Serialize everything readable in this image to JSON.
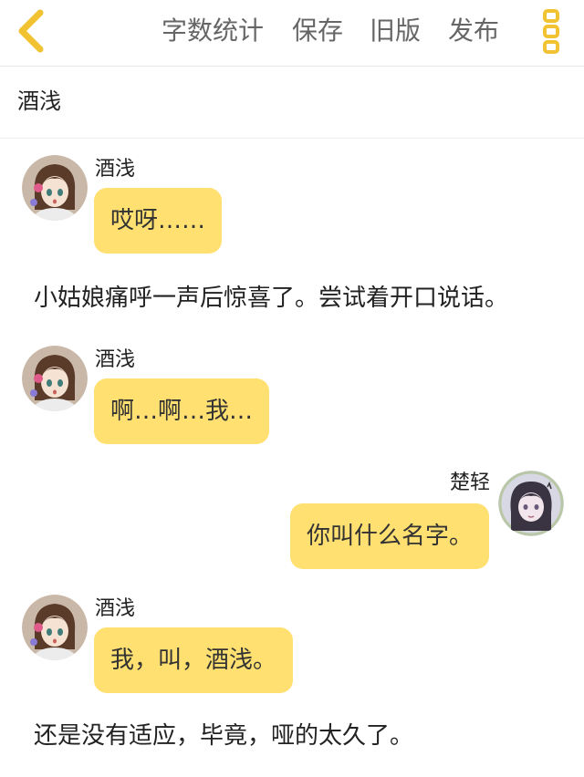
{
  "topbar": {
    "back_icon": "chevron-left-icon",
    "word_count_label": "字数统计",
    "save_label": "保存",
    "old_version_label": "旧版",
    "publish_label": "发布",
    "more_icon": "more-vertical-icon"
  },
  "title": "酒浅",
  "colors": {
    "accent": "#f1c232",
    "bubble": "#ffe071",
    "nav_text": "#666666"
  },
  "messages": [
    {
      "type": "chat",
      "side": "left",
      "sender": "酒浅",
      "text": "哎呀……"
    },
    {
      "type": "narration",
      "text": "小姑娘痛呼一声后惊喜了。尝试着开口说话。"
    },
    {
      "type": "chat",
      "side": "left",
      "sender": "酒浅",
      "text": "啊…啊…我…"
    },
    {
      "type": "chat",
      "side": "right",
      "sender": "楚轻",
      "text": "你叫什么名字。"
    },
    {
      "type": "chat",
      "side": "left",
      "sender": "酒浅",
      "text": "我，叫，酒浅。"
    },
    {
      "type": "narration",
      "text": "还是没有适应，毕竟，哑的太久了。"
    }
  ]
}
